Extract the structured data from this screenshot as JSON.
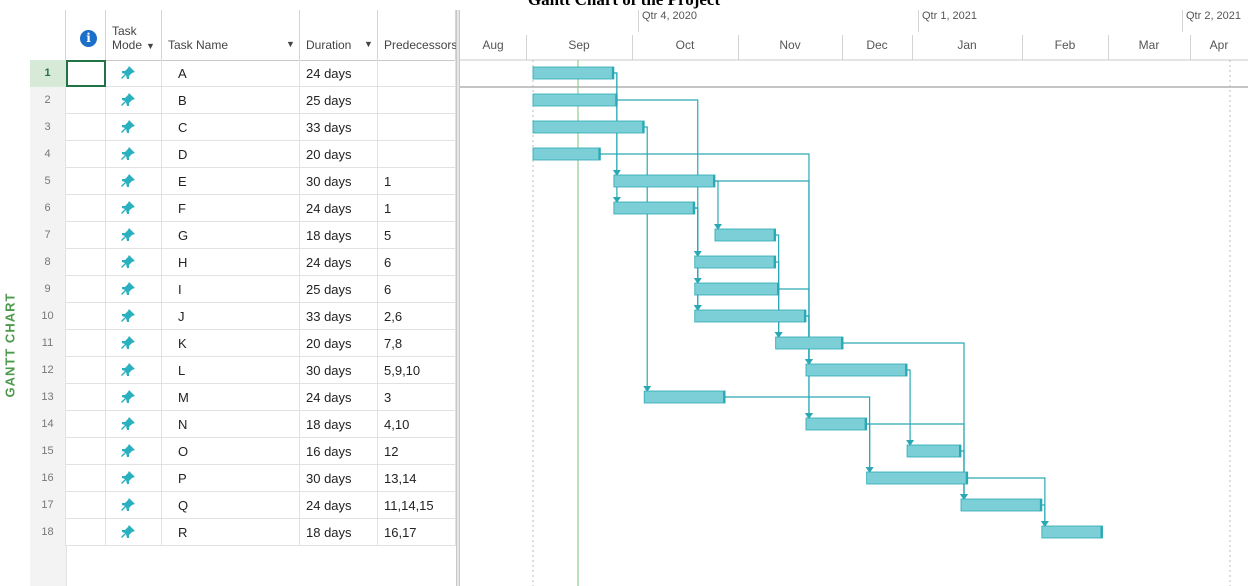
{
  "title": "Gantt Chart of the Project",
  "side_label": "GANTT CHART",
  "header": {
    "info_icon": "i",
    "task_mode_line1": "Task",
    "task_mode_line2": "Mode",
    "dropdown_arrow": "▼",
    "task_name": "Task Name",
    "duration": "Duration",
    "predecessors": "Predecessors"
  },
  "timeline": {
    "quarters": [
      "Qtr 4, 2020",
      "Qtr 1, 2021",
      "Qtr 2, 2021"
    ],
    "months": [
      "Aug",
      "Sep",
      "Oct",
      "Nov",
      "Dec",
      "Jan",
      "Feb",
      "Mar",
      "Apr"
    ]
  },
  "colors": {
    "bar": "#7ccfd6",
    "bar_edge": "#2aa9b5",
    "link": "#2aa9b5",
    "today": "#8fcf8f",
    "pin": "#2bb0c0"
  },
  "tasks": [
    {
      "id": "1",
      "name": "A",
      "duration": "24 days",
      "pred": ""
    },
    {
      "id": "2",
      "name": "B",
      "duration": "25 days",
      "pred": ""
    },
    {
      "id": "3",
      "name": "C",
      "duration": "33 days",
      "pred": ""
    },
    {
      "id": "4",
      "name": "D",
      "duration": "20 days",
      "pred": ""
    },
    {
      "id": "5",
      "name": "E",
      "duration": "30 days",
      "pred": "1"
    },
    {
      "id": "6",
      "name": "F",
      "duration": "24 days",
      "pred": "1"
    },
    {
      "id": "7",
      "name": "G",
      "duration": "18 days",
      "pred": "5"
    },
    {
      "id": "8",
      "name": "H",
      "duration": "24 days",
      "pred": "6"
    },
    {
      "id": "9",
      "name": "I",
      "duration": "25 days",
      "pred": "6"
    },
    {
      "id": "10",
      "name": "J",
      "duration": "33 days",
      "pred": "2,6"
    },
    {
      "id": "11",
      "name": "K",
      "duration": "20 days",
      "pred": "7,8"
    },
    {
      "id": "12",
      "name": "L",
      "duration": "30 days",
      "pred": "5,9,10"
    },
    {
      "id": "13",
      "name": "M",
      "duration": "24 days",
      "pred": "3"
    },
    {
      "id": "14",
      "name": "N",
      "duration": "18 days",
      "pred": "4,10"
    },
    {
      "id": "15",
      "name": "O",
      "duration": "16 days",
      "pred": "12"
    },
    {
      "id": "16",
      "name": "P",
      "duration": "30 days",
      "pred": "13,14"
    },
    {
      "id": "17",
      "name": "Q",
      "duration": "24 days",
      "pred": "11,14,15"
    },
    {
      "id": "18",
      "name": "R",
      "duration": "18 days",
      "pred": "16,17"
    }
  ]
}
